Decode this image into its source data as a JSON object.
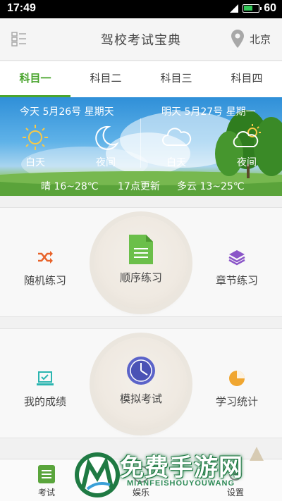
{
  "status_bar": {
    "time": "17:49",
    "battery": "60"
  },
  "header": {
    "title": "驾校考试宝典",
    "location": "北京"
  },
  "tabs": [
    {
      "label": "科目一",
      "active": true
    },
    {
      "label": "科目二",
      "active": false
    },
    {
      "label": "科目三",
      "active": false
    },
    {
      "label": "科目四",
      "active": false
    }
  ],
  "weather": {
    "today": {
      "date": "今天 5月26号 星期天",
      "day_label": "白天",
      "night_label": "夜间",
      "day_icon": "sun-icon",
      "night_icon": "moon-icon"
    },
    "tomorrow": {
      "date": "明天 5月27号 星期一",
      "day_label": "白天",
      "night_label": "夜间",
      "day_icon": "cloud-icon",
      "night_icon": "partly-cloudy-icon"
    },
    "footer": {
      "today_summary": "晴 16~28℃",
      "update_time": "17点更新",
      "tomorrow_summary": "多云 13~25℃"
    }
  },
  "practice": {
    "random": {
      "label": "随机练习",
      "icon": "shuffle-icon",
      "color": "#e8632a"
    },
    "sequential": {
      "label": "顺序练习",
      "icon": "document-icon",
      "color": "#6bbf4a"
    },
    "chapter": {
      "label": "章节练习",
      "icon": "layers-icon",
      "color": "#8a55c8"
    }
  },
  "exam": {
    "scores": {
      "label": "我的成绩",
      "icon": "laptop-check-icon",
      "color": "#2bb5b0"
    },
    "mock": {
      "label": "模拟考试",
      "icon": "clock-icon",
      "color": "#5b63c9"
    },
    "stats": {
      "label": "学习统计",
      "icon": "pie-chart-icon",
      "color": "#f0a630"
    }
  },
  "bottom_nav": [
    {
      "label": "考试",
      "icon": "exam-icon",
      "active": true
    },
    {
      "label": "娱乐",
      "icon": "entertainment-icon",
      "active": false
    },
    {
      "label": "设置",
      "icon": "settings-icon",
      "active": false
    }
  ],
  "watermark": {
    "title": "免费手游网",
    "subtitle": "MIANFEISHOUYOUWANG"
  }
}
